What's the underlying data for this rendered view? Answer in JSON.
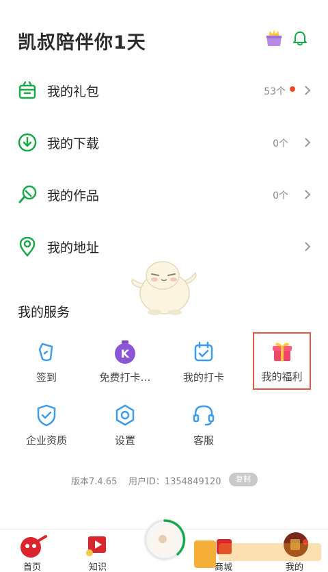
{
  "header": {
    "title": "凯叔陪伴你1天"
  },
  "menu": [
    {
      "name": "gift-box",
      "label": "我的礼包",
      "count": "53个",
      "has_dot": true
    },
    {
      "name": "download",
      "label": "我的下载",
      "count": "0个",
      "has_dot": false
    },
    {
      "name": "works",
      "label": "我的作品",
      "count": "0个",
      "has_dot": false
    },
    {
      "name": "address",
      "label": "我的地址",
      "count": "",
      "has_dot": false
    }
  ],
  "services": {
    "title": "我的服务",
    "items": [
      {
        "label": "签到",
        "icon": "tag-icon"
      },
      {
        "label": "免费打卡…",
        "icon": "k-medal-icon"
      },
      {
        "label": "我的打卡",
        "icon": "calendar-check-icon"
      },
      {
        "label": "我的福利",
        "icon": "gift-icon"
      },
      {
        "label": "企业资质",
        "icon": "shield-check-icon"
      },
      {
        "label": "设置",
        "icon": "settings-icon"
      },
      {
        "label": "客服",
        "icon": "headset-icon"
      }
    ]
  },
  "footer": {
    "version": "版本7.4.65",
    "uid": "用户ID：1354849120",
    "copy": "复制"
  },
  "tabbar": {
    "home": "首页",
    "knowledge": "知识",
    "mall": "商城",
    "mine": "我的"
  },
  "colors": {
    "green": "#1aa84b",
    "blue": "#3d9be9",
    "accent_red": "#f04a2a",
    "highlight": "#e2574c"
  }
}
